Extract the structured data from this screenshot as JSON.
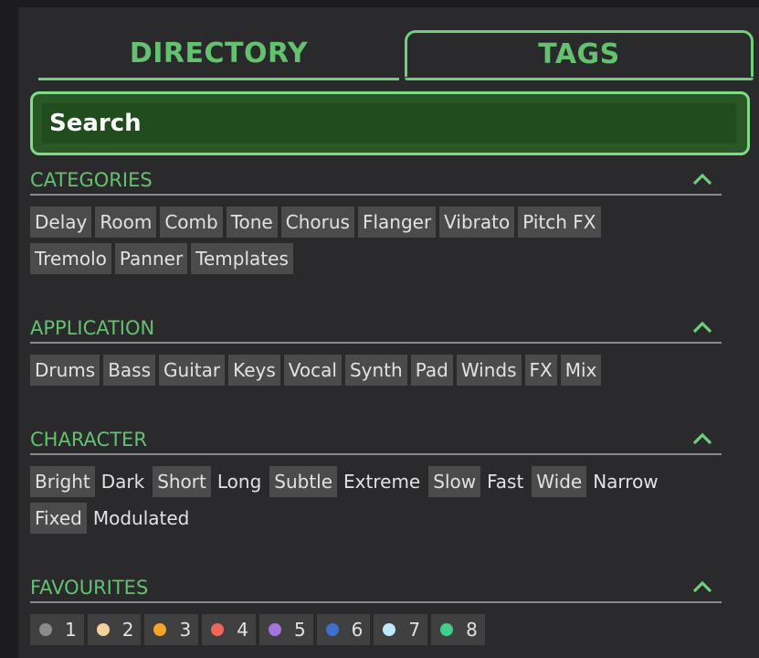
{
  "tabs": [
    {
      "label": "DIRECTORY"
    },
    {
      "label": "TAGS"
    }
  ],
  "search": {
    "placeholder": "Search"
  },
  "accent_color": "#62c36d",
  "sections": [
    {
      "title": "CATEGORIES",
      "rows": [
        [
          {
            "label": "Delay"
          },
          {
            "label": "Room"
          },
          {
            "label": "Comb"
          },
          {
            "label": "Tone"
          },
          {
            "label": "Chorus"
          },
          {
            "label": "Flanger"
          },
          {
            "label": "Vibrato"
          },
          {
            "label": "Pitch FX"
          }
        ],
        [
          {
            "label": "Tremolo"
          },
          {
            "label": "Panner"
          },
          {
            "label": "Templates"
          }
        ]
      ]
    },
    {
      "title": "APPLICATION",
      "rows": [
        [
          {
            "label": "Drums"
          },
          {
            "label": "Bass"
          },
          {
            "label": "Guitar"
          },
          {
            "label": "Keys"
          },
          {
            "label": "Vocal"
          },
          {
            "label": "Synth"
          },
          {
            "label": "Pad"
          },
          {
            "label": "Winds"
          },
          {
            "label": "FX"
          },
          {
            "label": "Mix"
          }
        ]
      ]
    },
    {
      "title": "CHARACTER",
      "rows": [
        [
          {
            "label": "Bright"
          },
          {
            "label": "Dark"
          },
          {
            "label": "Short"
          },
          {
            "label": "Long"
          },
          {
            "label": "Subtle"
          },
          {
            "label": "Extreme"
          },
          {
            "label": "Slow"
          },
          {
            "label": "Fast"
          },
          {
            "label": "Wide"
          },
          {
            "label": "Narrow"
          }
        ],
        [
          {
            "label": "Fixed"
          },
          {
            "label": "Modulated"
          }
        ]
      ]
    },
    {
      "title": "FAVOURITES",
      "favourites": [
        {
          "label": "1",
          "color": "#8a8a8a"
        },
        {
          "label": "2",
          "color": "#f3d39b"
        },
        {
          "label": "3",
          "color": "#f6a623"
        },
        {
          "label": "4",
          "color": "#f0655a"
        },
        {
          "label": "5",
          "color": "#a574e0"
        },
        {
          "label": "6",
          "color": "#3f6fcf"
        },
        {
          "label": "7",
          "color": "#bfe8ff"
        },
        {
          "label": "8",
          "color": "#3dcf8e"
        }
      ]
    }
  ],
  "icons": {
    "collapse": "chevron-up-icon"
  }
}
